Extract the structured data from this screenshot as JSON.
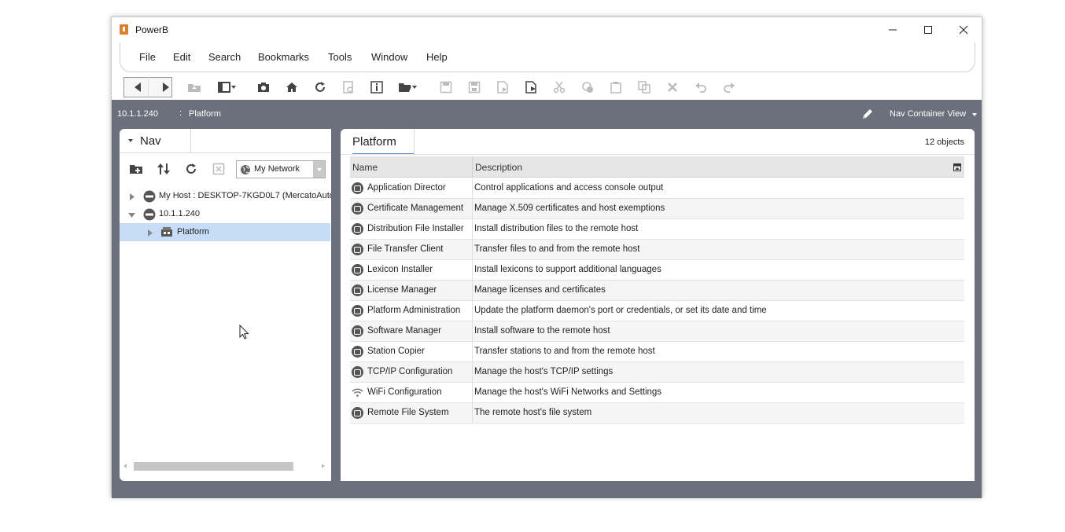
{
  "window": {
    "title": "PowerB",
    "controls": {
      "minimize": "—",
      "maximize": "☐",
      "close": "✕"
    }
  },
  "menu": [
    "File",
    "Edit",
    "Search",
    "Bookmarks",
    "Tools",
    "Window",
    "Help"
  ],
  "location": {
    "host": "10.1.1.240",
    "separator": ":",
    "page": "Platform",
    "view": "Nav Container View"
  },
  "nav": {
    "tab_label": "Nav",
    "network_select": "My Network",
    "tree": [
      {
        "label": "My Host : DESKTOP-7KGD0L7 (MercatoAuto",
        "expanded": false
      },
      {
        "label": "10.1.1.240",
        "expanded": true
      },
      {
        "label": "Platform",
        "expanded": false,
        "selected": true
      }
    ]
  },
  "main": {
    "tab_label": "Platform",
    "object_count": "12 objects",
    "columns": {
      "name": "Name",
      "description": "Description"
    },
    "rows": [
      {
        "icon": "application-director-icon",
        "name": "Application Director",
        "description": "Control applications and access console output"
      },
      {
        "icon": "certificate-icon",
        "name": "Certificate Management",
        "description": "Manage X.509 certificates and host exemptions"
      },
      {
        "icon": "distribution-icon",
        "name": "Distribution File Installer",
        "description": "Install distribution files to the remote host"
      },
      {
        "icon": "file-transfer-icon",
        "name": "File Transfer Client",
        "description": "Transfer files to and from the remote host"
      },
      {
        "icon": "lexicon-icon",
        "name": "Lexicon Installer",
        "description": "Install lexicons to support additional languages"
      },
      {
        "icon": "license-icon",
        "name": "License Manager",
        "description": "Manage licenses and certificates"
      },
      {
        "icon": "platform-admin-icon",
        "name": "Platform Administration",
        "description": "Update the platform daemon's port or credentials, or set its date and time"
      },
      {
        "icon": "software-icon",
        "name": "Software Manager",
        "description": "Install software to the remote host"
      },
      {
        "icon": "station-copier-icon",
        "name": "Station Copier",
        "description": "Transfer stations to and from the remote host"
      },
      {
        "icon": "network-config-icon",
        "name": "TCP/IP Configuration",
        "description": "Manage the host's TCP/IP settings"
      },
      {
        "icon": "wifi-icon",
        "name": "WiFi Configuration",
        "description": "Manage the host's WiFi Networks and Settings"
      },
      {
        "icon": "remote-file-system-icon",
        "name": "Remote File System",
        "description": "The remote host's file system"
      }
    ]
  }
}
